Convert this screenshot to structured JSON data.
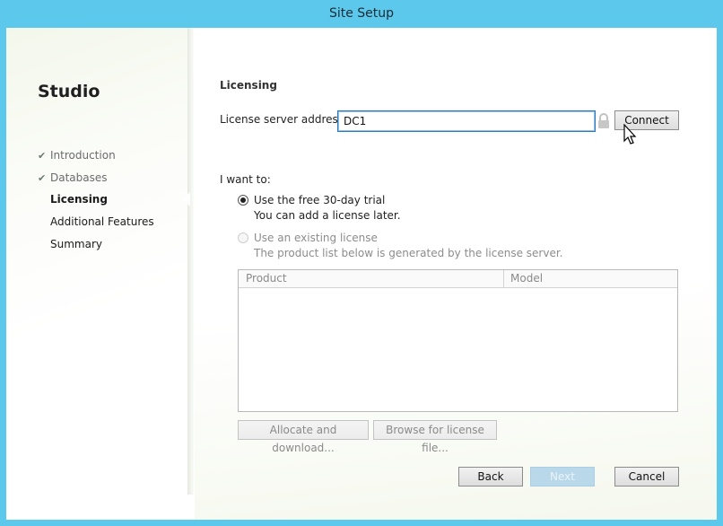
{
  "window": {
    "title": "Site Setup"
  },
  "sidebar": {
    "app_title": "Studio",
    "steps": [
      {
        "label": "Introduction",
        "state": "completed"
      },
      {
        "label": "Databases",
        "state": "completed"
      },
      {
        "label": "Licensing",
        "state": "current"
      },
      {
        "label": "Additional Features",
        "state": "pending"
      },
      {
        "label": "Summary",
        "state": "pending"
      }
    ]
  },
  "licensing": {
    "heading": "Licensing",
    "server_label": "License server address:",
    "server_value": "DC1",
    "connect_label": "Connect",
    "i_want_to": "I want to:",
    "options": [
      {
        "label": "Use the free 30-day trial",
        "sub": "You can add a license later.",
        "selected": true,
        "enabled": true
      },
      {
        "label": "Use an existing license",
        "sub": "The product list below is generated by the license server.",
        "selected": false,
        "enabled": false
      }
    ],
    "table": {
      "columns": [
        "Product",
        "Model"
      ],
      "rows": []
    },
    "allocate_label": "Allocate and download...",
    "browse_label": "Browse for license file..."
  },
  "footer": {
    "back_label": "Back",
    "next_label": "Next",
    "cancel_label": "Cancel"
  },
  "colors": {
    "titlebar": "#5bc8ec",
    "accent_border": "#2a7bbf",
    "next_disabled": "#b9d9ea"
  },
  "icons": {
    "check": "check-mark-icon",
    "lock": "lock-icon",
    "cursor": "mouse-pointer-icon"
  }
}
